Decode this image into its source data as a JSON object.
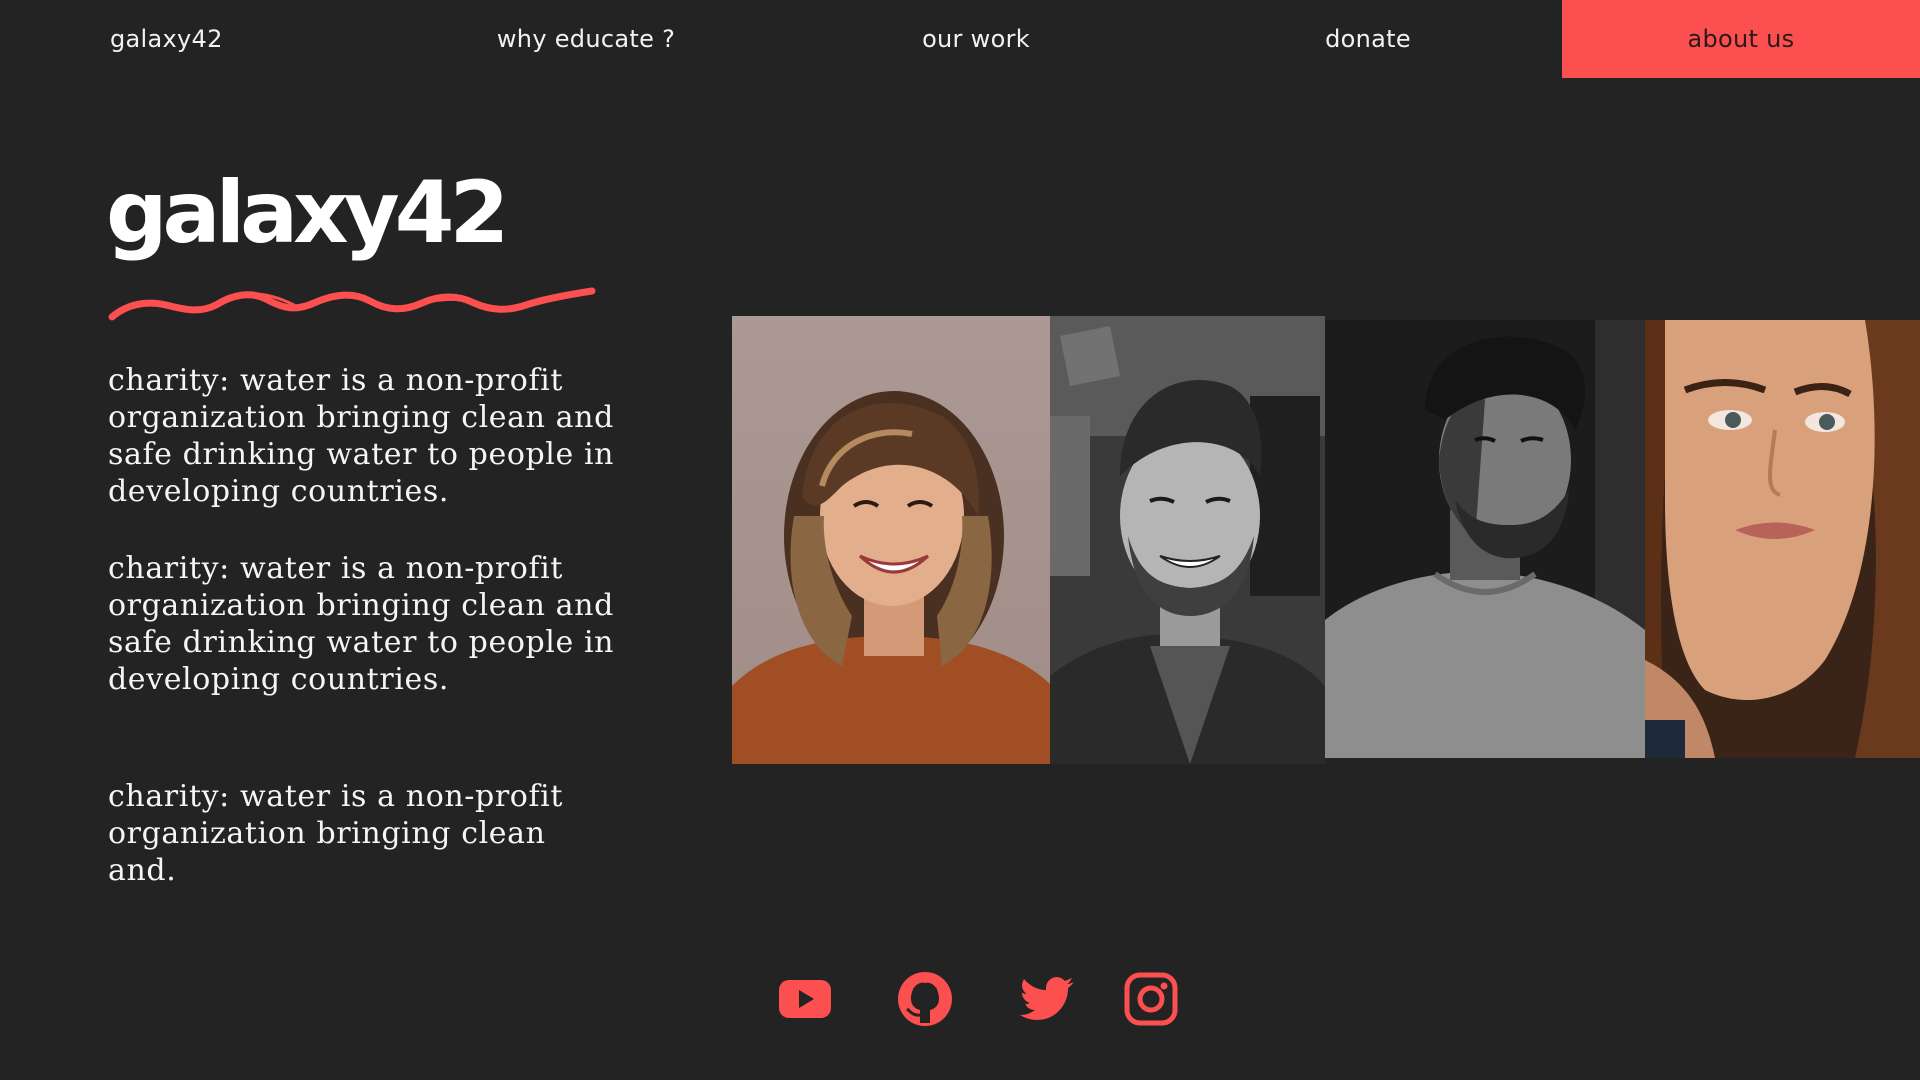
{
  "nav": {
    "brand": "galaxy42",
    "items": [
      {
        "label": "why educate ?"
      },
      {
        "label": "our work"
      },
      {
        "label": "donate"
      },
      {
        "label": "about us",
        "active": true
      }
    ]
  },
  "hero": {
    "logo_text": "galaxy42",
    "paragraphs": [
      "charity: water is a non-profit organization bringing clean and safe drinking water to people in developing countries.",
      "charity: water is a non-profit organization bringing clean and safe drinking water to people in developing countries.",
      "charity: water is a non-profit organization bringing clean and."
    ]
  },
  "photos": [
    {
      "name": "smiling-woman-photo",
      "tone": "color"
    },
    {
      "name": "smiling-man-photo",
      "tone": "grayscale"
    },
    {
      "name": "bearded-man-photo",
      "tone": "grayscale"
    },
    {
      "name": "woman-portrait-photo",
      "tone": "color"
    }
  ],
  "social": [
    {
      "icon": "youtube-icon"
    },
    {
      "icon": "github-icon"
    },
    {
      "icon": "twitter-icon"
    },
    {
      "icon": "instagram-icon"
    }
  ],
  "colors": {
    "background": "#232323",
    "accent": "#fc4f4f",
    "text": "#f5f5f5"
  }
}
